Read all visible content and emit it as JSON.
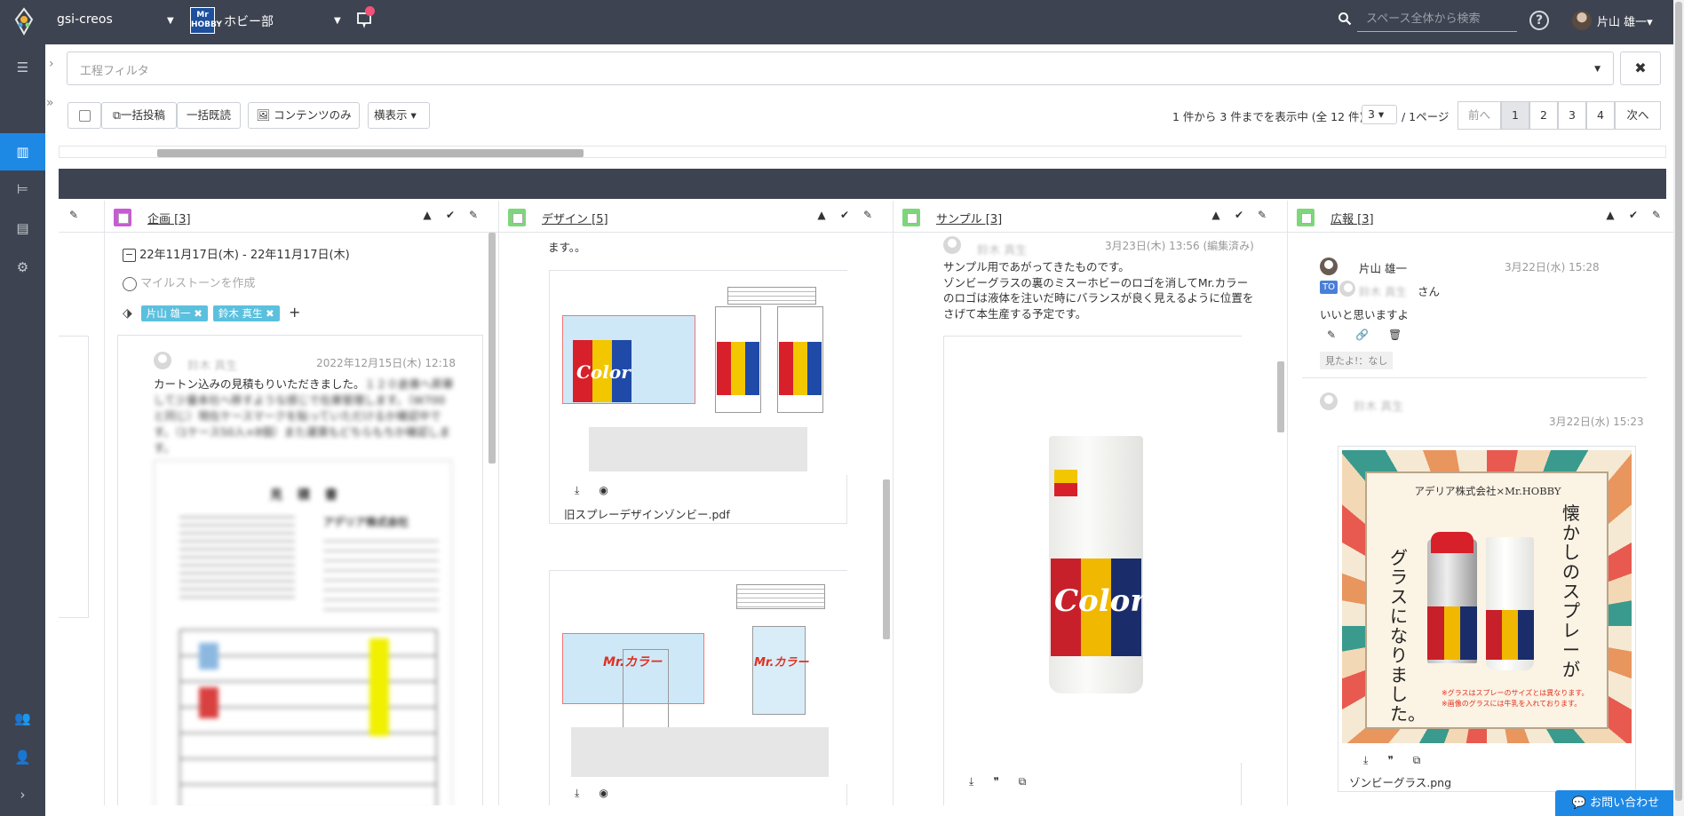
{
  "topbar": {
    "space_name": "gsi-creos",
    "project_logo_text": "Mr HOBBY",
    "project_name": "ホビー部",
    "search_placeholder": "スペース全体から検索",
    "help_label": "?",
    "user_name": "片山 雄一▾"
  },
  "filter": {
    "placeholder": "工程フィルタ",
    "clear_label": "✖"
  },
  "toolbar": {
    "bulk_post_label": "一括投稿",
    "bulk_read_label": "一括既読",
    "contents_only_label": "コンテンツのみ",
    "display_mode": "横表示 ▾",
    "paging_text": "1 件から 3 件までを表示中 (全 12 件)",
    "per_page": "3 ▾",
    "page_suffix": "/ 1ページ",
    "prev_label": "前へ",
    "pages": [
      "1",
      "2",
      "3",
      "4"
    ],
    "next_label": "次へ"
  },
  "columns": [
    {
      "title": "企画 [3]",
      "color": "#c75bd6"
    },
    {
      "title": "デザイン [5]",
      "color": "#7ed67b"
    },
    {
      "title": "サンプル [3]",
      "color": "#7ed67b"
    },
    {
      "title": "広報 [3]",
      "color": "#7ed67b"
    }
  ],
  "kikaku": {
    "date_range": "22年11月17日(木) - 22年11月17日(木)",
    "milestone": "マイルストーンを作成",
    "tags": [
      "片山 雄一 ✖",
      "鈴木 真生 ✖"
    ],
    "add_tag": "+",
    "comment_author": "鈴木 真生",
    "comment_date": "2022年12月15日(木) 12:18",
    "comment_line1": "カートン込みの見積もりいただきました。",
    "comment_blur": "１２０倉庫へ昇華して少量本社へ移すような感じで在庫管理します。（W700と同じ）現在ケースマークを貼っていただけるか確認中です。（1ケース50入×8個）また運賃もどちらもちか確認します。",
    "document_title": "見 積 書",
    "document_company": "アデリア株式会社"
  },
  "design": {
    "top_text": "ます。。",
    "file1_name": "旧スプレーデザインゾンビー.pdf",
    "file1_color_label": "Color",
    "file2_brand_label": "Mr.カラー"
  },
  "sample": {
    "author": "鈴木 真生",
    "date": "3月23日(木) 13:56 (編集済み)",
    "body_lines": [
      "サンプル用であがってきたものです。",
      "ゾンビーグラスの裏のミスーホビーのロゴを消してMr.カラー",
      "のロゴは液体を注いだ時にバランスが良く見えるように位置を",
      "さげて本生産する予定です。"
    ],
    "glass_label": "Color"
  },
  "kouhou": {
    "reply_author": "片山 雄一",
    "reply_date": "3月22日(水) 15:28",
    "to_badge": "TO",
    "to_name": "鈴木 真生",
    "to_suffix": "さん",
    "reply_text": "いいと思いますよ",
    "seen_text": "見たよ!：なし",
    "post_author": "鈴木 真生",
    "post_date": "3月22日(水) 15:23",
    "poster_header": "アデリア株式会社×Mr.HOBBY",
    "poster_title_right": "懐かしのスプレーが",
    "poster_title_left": "グラスになりました。",
    "poster_note1": "※グラスはスプレーのサイズとは異なります。",
    "poster_note2": "※画像のグラスには牛乳を入れております。",
    "file_name": "ゾンビーグラス.png"
  },
  "contact_label": "お問い合わせ",
  "colors": {
    "topbar": "#3d4350",
    "accent": "#1e88e5",
    "tag": "#5bc0de"
  }
}
